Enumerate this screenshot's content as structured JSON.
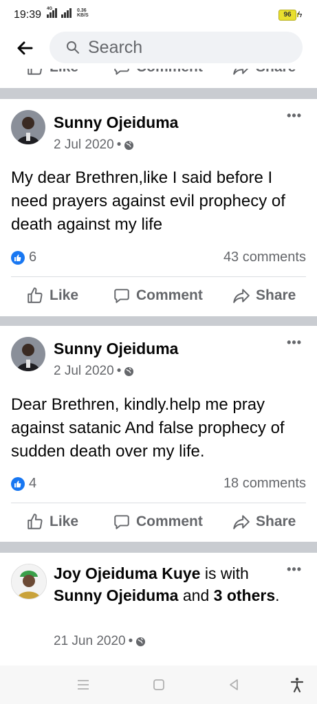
{
  "status": {
    "time": "19:39",
    "network_tag": "4G",
    "speed_value": "0.36",
    "speed_unit": "KB/S",
    "battery": "96"
  },
  "search": {
    "placeholder": "Search"
  },
  "actions": {
    "like": "Like",
    "comment": "Comment",
    "share": "Share"
  },
  "posts": [
    {
      "author": "Sunny Ojeiduma",
      "date": "2 Jul 2020",
      "text": "My dear Brethren,like I said before I need prayers against evil prophecy of death against my life",
      "likes": "6",
      "comments": "43 comments"
    },
    {
      "author": "Sunny Ojeiduma",
      "date": "2 Jul 2020",
      "text": "Dear Brethren, kindly.help me pray against satanic And false prophecy of sudden death over my life.",
      "likes": "4",
      "comments": "18 comments"
    }
  ],
  "shared_post": {
    "author": "Joy Ojeiduma Kuye",
    "is_with": "is with",
    "tagged": "Sunny Ojeiduma",
    "and": "and",
    "others": "3 others",
    "period": ".",
    "date": "21 Jun 2020"
  },
  "colors": {
    "facebook_blue": "#1877f2",
    "secondary_text": "#65676b",
    "divider": "#c9ccd1"
  },
  "icons": {
    "back": "arrow-left-icon",
    "search": "magnifier-icon",
    "like": "thumbs-up-icon",
    "comment": "speech-bubble-icon",
    "share": "share-arrow-icon",
    "privacy": "globe-icon",
    "more": "ellipsis-icon"
  }
}
